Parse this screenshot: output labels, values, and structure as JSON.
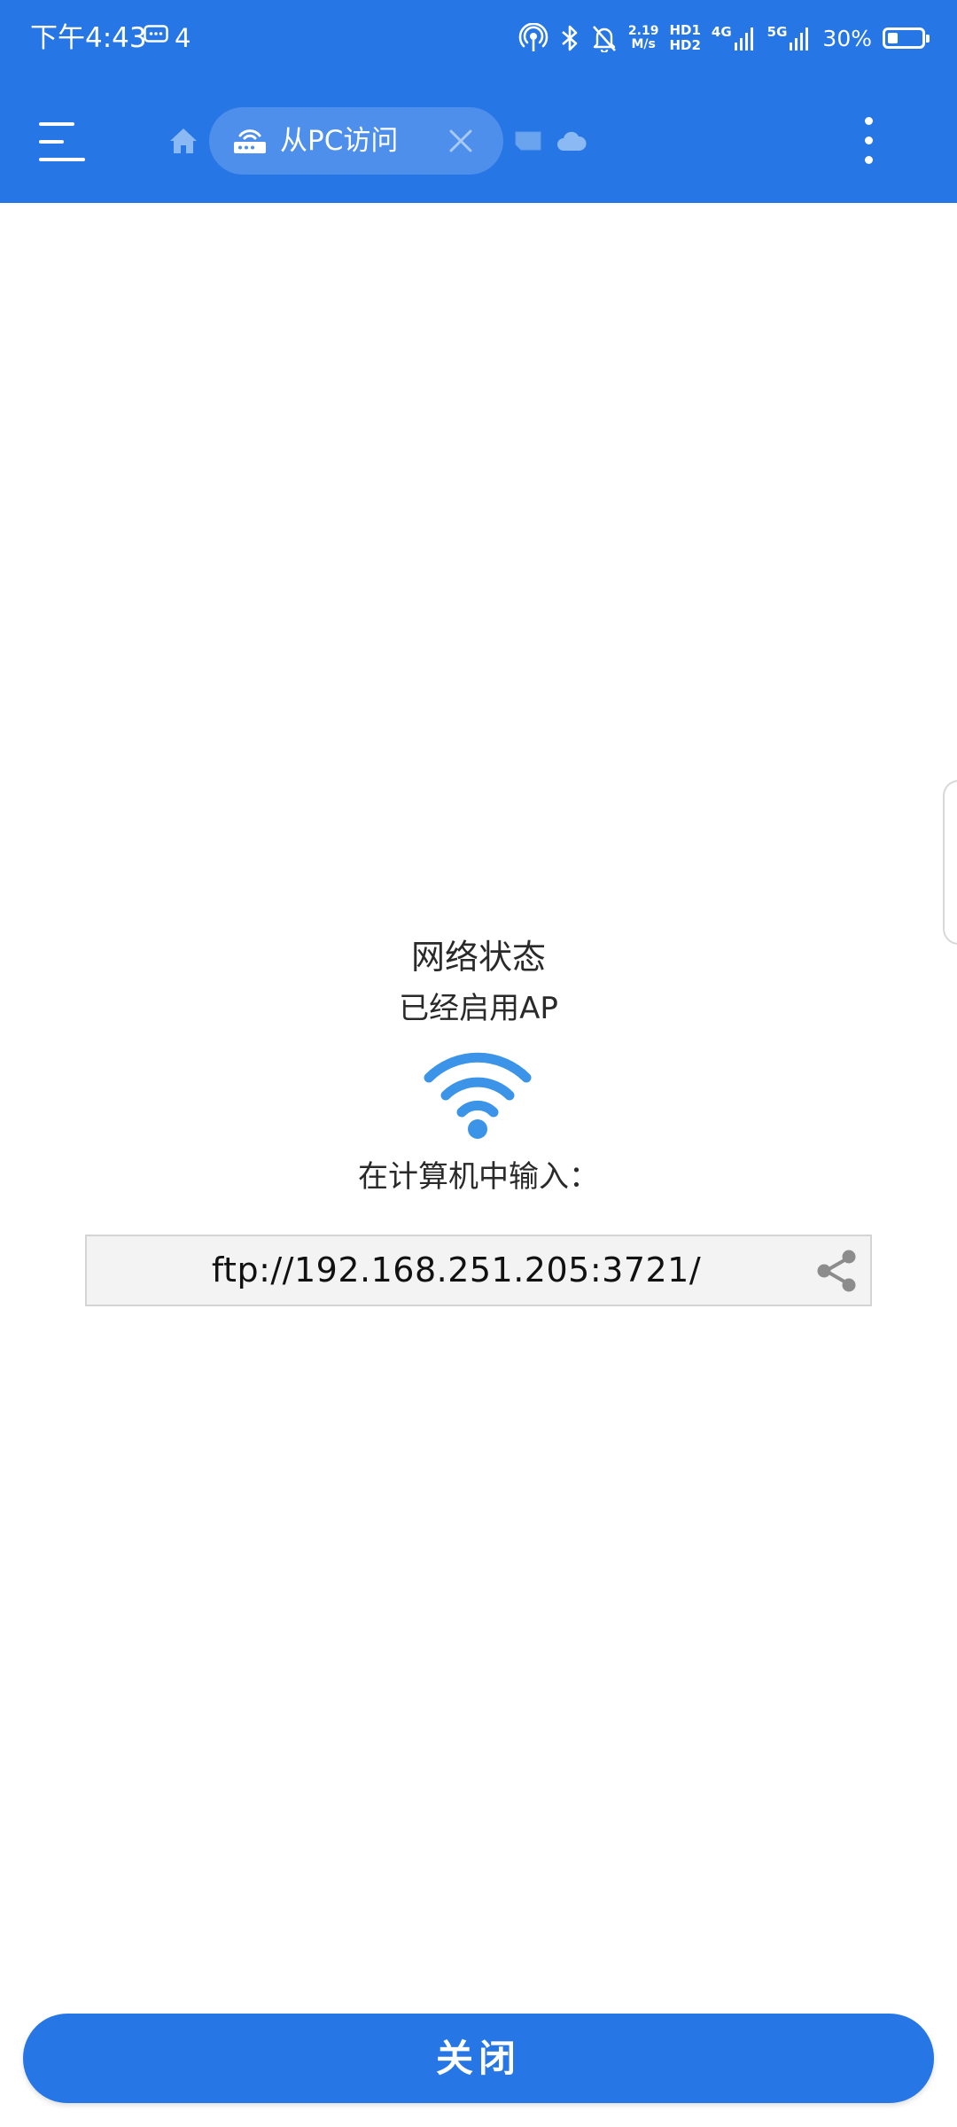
{
  "status_bar": {
    "time": "下午4:43",
    "message_count": "4",
    "speed_value": "2.19",
    "speed_unit": "M/s",
    "hd1": "HD1",
    "hd2": "HD2",
    "network_4g": "4G",
    "network_5g": "5G",
    "battery_text": "30%",
    "battery_level": 0.3,
    "icons": [
      "message-icon",
      "hotspot-icon",
      "bluetooth-icon",
      "bell-off-icon",
      "signal-icon",
      "battery-icon"
    ]
  },
  "app_bar": {
    "background_color": "#2676e5",
    "menu_icon": "hamburger-menu-icon",
    "home_icon": "home-icon",
    "active_tab": {
      "icon": "router-icon",
      "label": "从PC访问",
      "close_icon": "close-icon"
    },
    "storage_icon": "sd-card-icon",
    "cloud_icon": "cloud-icon",
    "overflow_icon": "more-vertical-icon"
  },
  "content": {
    "network_title": "网络状态",
    "network_status": "已经启用AP",
    "status_icon": "wifi-icon",
    "status_icon_color": "#3b94e8",
    "input_hint": "在计算机中输入：",
    "ftp_address": "ftp://192.168.251.205:3721/",
    "share_icon": "share-icon"
  },
  "footer": {
    "close_label": "关闭",
    "button_color": "#2676e5"
  }
}
